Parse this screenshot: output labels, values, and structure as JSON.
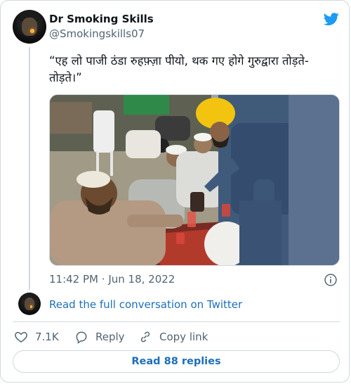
{
  "tweet": {
    "author_name": "Dr Smoking Skills",
    "author_handle": "@Smokingskills07",
    "text": "“एह लो पाजी ठंडा रुहफ़्ज़ा पीयो, थक गए होगे गुरुद्वारा तोड़ते-तोड़ते।”",
    "time": "11:42 PM",
    "separator": "·",
    "date": "Jun 18, 2022",
    "read_conversation_label": "Read the full conversation on Twitter"
  },
  "actions": {
    "like_count": "7.1K",
    "reply_label": "Reply",
    "copy_link_label": "Copy link",
    "read_replies_label": "Read 88 replies"
  },
  "icons": {
    "brand": "twitter-bird-icon",
    "info": "info-icon",
    "like": "heart-icon",
    "reply": "speech-bubble-icon",
    "copy": "link-icon"
  },
  "colors": {
    "brand_blue": "#1d9bf0",
    "link_blue": "#1d6fb8",
    "muted_text": "#536471",
    "border": "#cfd9de"
  }
}
